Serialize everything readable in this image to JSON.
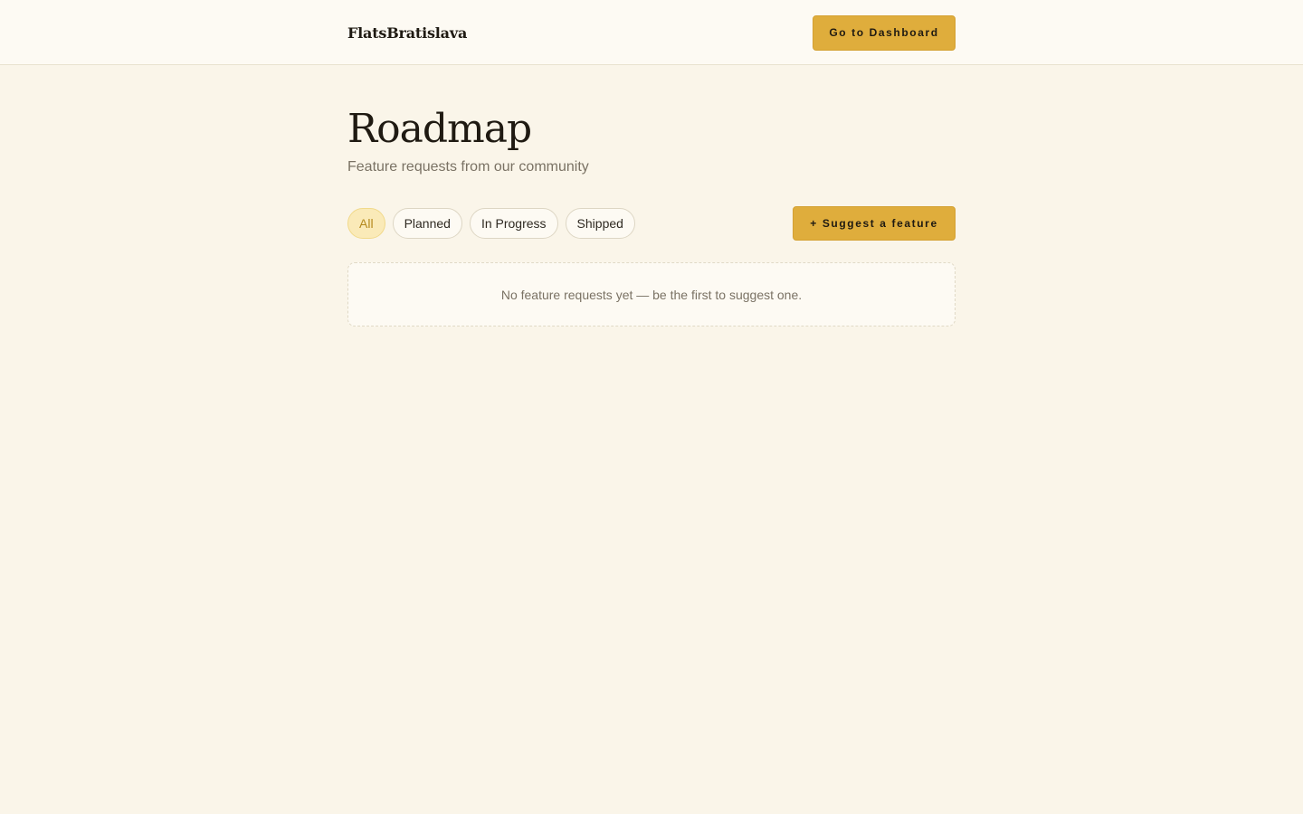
{
  "header": {
    "brand": "FlatsBratislava",
    "dashboard_button": "Go to Dashboard"
  },
  "page": {
    "title": "Roadmap",
    "subtitle": "Feature requests from our community"
  },
  "filters": {
    "items": [
      {
        "label": "All",
        "active": true
      },
      {
        "label": "Planned",
        "active": false
      },
      {
        "label": "In Progress",
        "active": false
      },
      {
        "label": "Shipped",
        "active": false
      }
    ],
    "suggest_button": "+ Suggest a feature"
  },
  "empty_state": {
    "message": "No feature requests yet — be the first to suggest one."
  },
  "colors": {
    "background": "#faf5e9",
    "accent": "#dfad3c",
    "active_pill_bg": "#faeab8",
    "active_pill_text": "#b58a1e"
  }
}
